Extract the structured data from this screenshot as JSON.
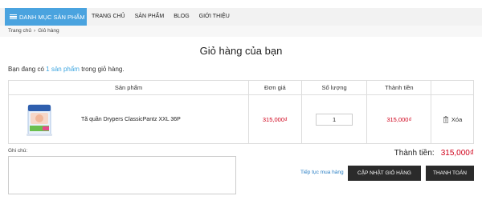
{
  "nav": {
    "category_label": "Danh mục sản phẩm",
    "items": [
      "Trang chủ",
      "Sản phẩm",
      "Blog",
      "Giới thiệu"
    ]
  },
  "breadcrumb": {
    "home": "Trang chủ",
    "separator": "›",
    "current": "Giỏ hàng"
  },
  "page_title": "Giỏ hàng của bạn",
  "summary": {
    "prefix": "Bạn đang có ",
    "count_text": "1 sản phẩm",
    "suffix": " trong giỏ hàng."
  },
  "table": {
    "headers": [
      "Sản phẩm",
      "Đơn giá",
      "Số lượng",
      "Thành tiền",
      ""
    ],
    "rows": [
      {
        "image_icon": "diaper-pack-image",
        "name": "Tã quần Drypers ClassicPantz XXL 36P",
        "unit_price": "315,000₫",
        "quantity": "1",
        "line_total": "315,000₫",
        "remove_label": "Xóa"
      }
    ]
  },
  "notes": {
    "label": "Ghi chú:",
    "value": ""
  },
  "total": {
    "label": "Thành tiền:",
    "value": "315,000₫"
  },
  "actions": {
    "continue_label": "Tiếp tục mua hàng",
    "update_label": "Cập nhật giỏ hàng",
    "checkout_label": "Thanh toán"
  },
  "colors": {
    "accent": "#4aa3df",
    "price": "#d0021b",
    "button": "#2b2b2b"
  }
}
